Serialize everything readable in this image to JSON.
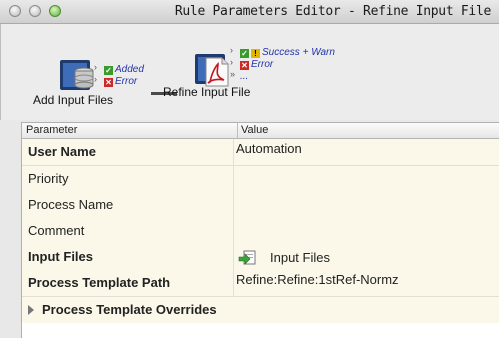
{
  "window": {
    "title": "Rule Parameters Editor - Refine Input File"
  },
  "flow": {
    "source": {
      "label": "Add Input Files",
      "ports": [
        {
          "label": "Added",
          "status": "ok"
        },
        {
          "label": "Error",
          "status": "error"
        }
      ]
    },
    "target": {
      "label": "Refine Input File",
      "ports": [
        {
          "label": "Success + Warn",
          "status": "ok-warn"
        },
        {
          "label": "Error",
          "status": "error"
        },
        {
          "label": "...",
          "status": "more"
        }
      ]
    }
  },
  "table": {
    "columns": [
      "Parameter",
      "Value"
    ],
    "rows": [
      {
        "name": "User Name",
        "value": "Automation",
        "bold": true
      },
      {
        "name": "Priority",
        "value": "",
        "bold": false
      },
      {
        "name": "Process Name",
        "value": "",
        "bold": false
      },
      {
        "name": "Comment",
        "value": "",
        "bold": false
      },
      {
        "name": "Input Files",
        "value": "Input Files",
        "bold": true
      },
      {
        "name": "Process Template Path",
        "value": "Refine:Refine:1stRef-Normz",
        "bold": true
      },
      {
        "name": "Process Template Overrides",
        "value": "",
        "bold": true
      }
    ]
  }
}
